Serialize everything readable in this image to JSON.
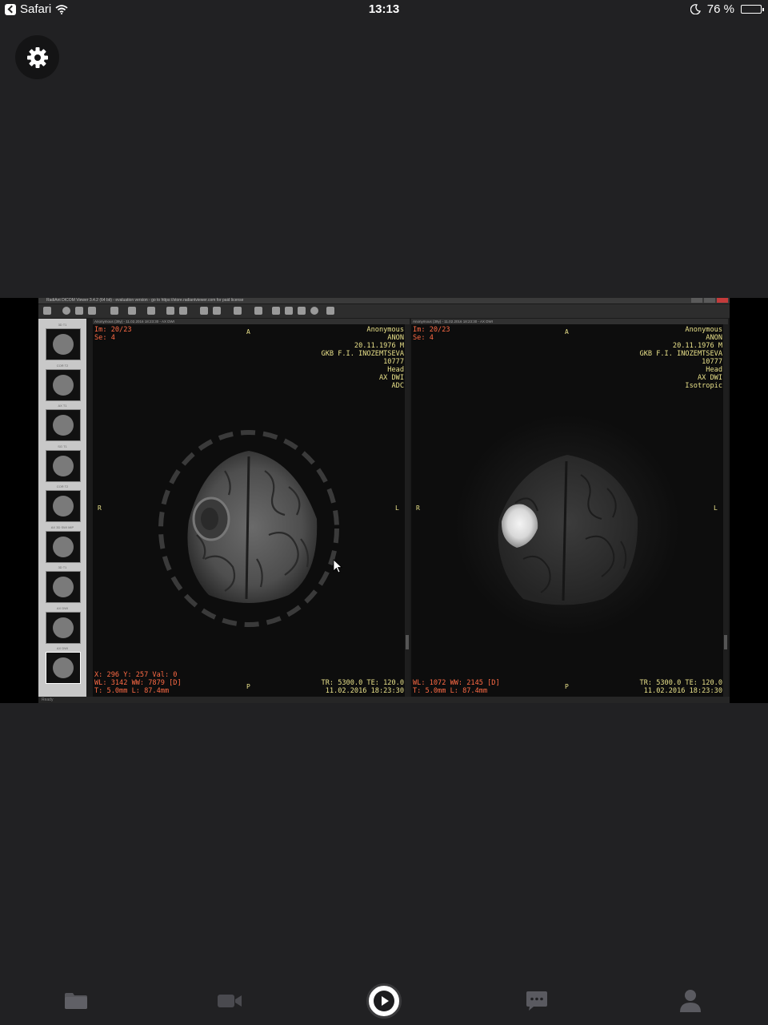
{
  "statusbar": {
    "back_app": "Safari",
    "time": "13:13",
    "battery_percent": "76 %",
    "battery_level": 0.76
  },
  "settings": {
    "icon": "gear-icon"
  },
  "viewer": {
    "window_title": "RadiAnt DICOM Viewer 3.4.2 (64 bit) - evaluation version - go to https://store.radiantviewer.com for paid license",
    "status": "Ready",
    "thumbnails": [
      {
        "label": "3D T1"
      },
      {
        "label": "COR T2"
      },
      {
        "label": "AX T1"
      },
      {
        "label": "SG T1"
      },
      {
        "label": "COR T2"
      },
      {
        "label": "AX 3D SWI MIP"
      },
      {
        "label": "3D T1"
      },
      {
        "label": "AX DWI"
      },
      {
        "label": "AX DWI"
      }
    ],
    "left": {
      "header": "Anonymous (39y) - 11.02.2016 18:23:30 - AX DWI",
      "im": "Im: 20/23",
      "se": "Se: 4",
      "info": [
        "Anonymous",
        "ANON",
        "20.11.1976 M",
        "GKB F.I. INOZEMTSEVA",
        "10777",
        "Head",
        "AX DWI",
        "ADC"
      ],
      "orient": {
        "top": "A",
        "bottom": "P",
        "left": "R",
        "right": "L"
      },
      "bottom_left": [
        "X: 296 Y: 257 Val: 0",
        "WL: 3142 WW: 7879 [D]",
        "T: 5.0mm L: 87.4mm"
      ],
      "bottom_right": [
        "TR: 5300.0 TE: 120.0",
        "11.02.2016 18:23:30"
      ]
    },
    "right": {
      "header": "Anonymous (39y) - 11.02.2016 18:23:30 - AX DWI",
      "im": "Im: 20/23",
      "se": "Se: 4",
      "info": [
        "Anonymous",
        "ANON",
        "20.11.1976 M",
        "GKB F.I. INOZEMTSEVA",
        "10777",
        "Head",
        "AX DWI",
        "Isotropic"
      ],
      "orient": {
        "top": "A",
        "bottom": "P",
        "left": "R",
        "right": "L"
      },
      "bottom_left": [
        "WL: 1072 WW: 2145 [D]",
        "T: 5.0mm L: 87.4mm"
      ],
      "bottom_right": [
        "TR: 5300.0 TE: 120.0",
        "11.02.2016 18:23:30"
      ]
    }
  },
  "tabbar": {
    "items": [
      {
        "icon": "folder-icon"
      },
      {
        "icon": "video-camera-icon"
      },
      {
        "icon": "play-icon"
      },
      {
        "icon": "chat-icon"
      },
      {
        "icon": "person-icon"
      }
    ]
  }
}
